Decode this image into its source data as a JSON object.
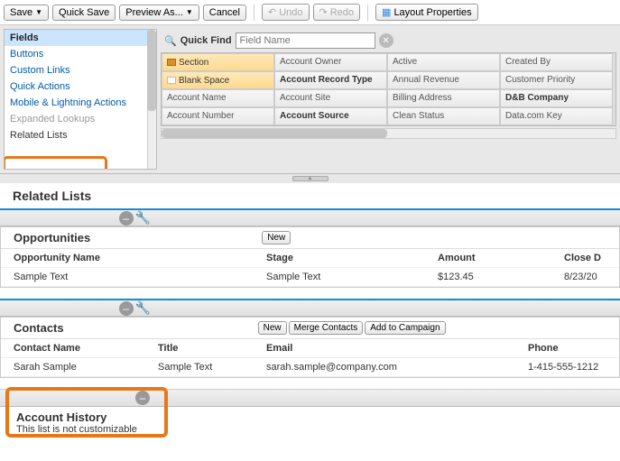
{
  "toolbar": {
    "save": "Save",
    "quick_save": "Quick Save",
    "preview": "Preview As...",
    "cancel": "Cancel",
    "undo": "Undo",
    "redo": "Redo",
    "layout_props": "Layout Properties"
  },
  "sidebar": {
    "items": [
      "Fields",
      "Buttons",
      "Custom Links",
      "Quick Actions",
      "Mobile & Lightning Actions",
      "Expanded Lookups",
      "Related Lists"
    ]
  },
  "quickfind": {
    "label": "Quick Find",
    "placeholder": "Field Name"
  },
  "palette": {
    "c0": [
      "Section",
      "Blank Space",
      "Account Name",
      "Account Number"
    ],
    "c1": [
      "Account Owner",
      "Account Record Type",
      "Account Site",
      "Account Source"
    ],
    "c2": [
      "Active",
      "Annual Revenue",
      "Billing Address",
      "Clean Status"
    ],
    "c3": [
      "Created By",
      "Customer Priority",
      "D&B Company",
      "Data.com Key"
    ]
  },
  "section_header": "Related Lists",
  "opportunities": {
    "title": "Opportunities",
    "new": "New",
    "cols": [
      "Opportunity Name",
      "Stage",
      "Amount",
      "Close D"
    ],
    "row": [
      "Sample Text",
      "Sample Text",
      "$123.45",
      "8/23/20"
    ]
  },
  "contacts": {
    "title": "Contacts",
    "new": "New",
    "merge": "Merge Contacts",
    "camp": "Add to Campaign",
    "cols": [
      "Contact Name",
      "Title",
      "Email",
      "Phone"
    ],
    "row": [
      "Sarah Sample",
      "Sample Text",
      "sarah.sample@company.com",
      "1-415-555-1212"
    ]
  },
  "account_history": {
    "title": "Account History",
    "sub": "This list is not customizable"
  }
}
